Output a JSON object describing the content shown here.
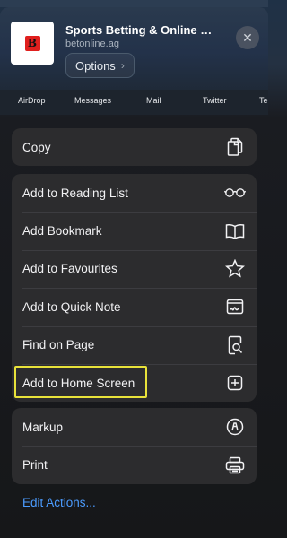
{
  "site": {
    "title": "Sports Betting & Online Be...",
    "url": "betonline.ag",
    "options_label": "Options",
    "logo_letter": "B"
  },
  "share_targets": [
    "AirDrop",
    "Messages",
    "Mail",
    "Twitter",
    "Te"
  ],
  "groups": [
    {
      "items": [
        {
          "label": "Copy",
          "icon": "copy-icon"
        }
      ]
    },
    {
      "items": [
        {
          "label": "Add to Reading List",
          "icon": "glasses-icon"
        },
        {
          "label": "Add Bookmark",
          "icon": "book-icon"
        },
        {
          "label": "Add to Favourites",
          "icon": "star-icon"
        },
        {
          "label": "Add to Quick Note",
          "icon": "quick-note-icon"
        },
        {
          "label": "Find on Page",
          "icon": "find-page-icon"
        },
        {
          "label": "Add to Home Screen",
          "icon": "plus-square-icon"
        }
      ]
    },
    {
      "items": [
        {
          "label": "Markup",
          "icon": "markup-icon"
        },
        {
          "label": "Print",
          "icon": "printer-icon"
        }
      ]
    }
  ],
  "edit_actions_label": "Edit Actions...",
  "colors": {
    "accent": "#4b9cff",
    "highlight": "#e8e23a",
    "row_bg": "#2c2c2e",
    "logo_red": "#e0201e"
  }
}
